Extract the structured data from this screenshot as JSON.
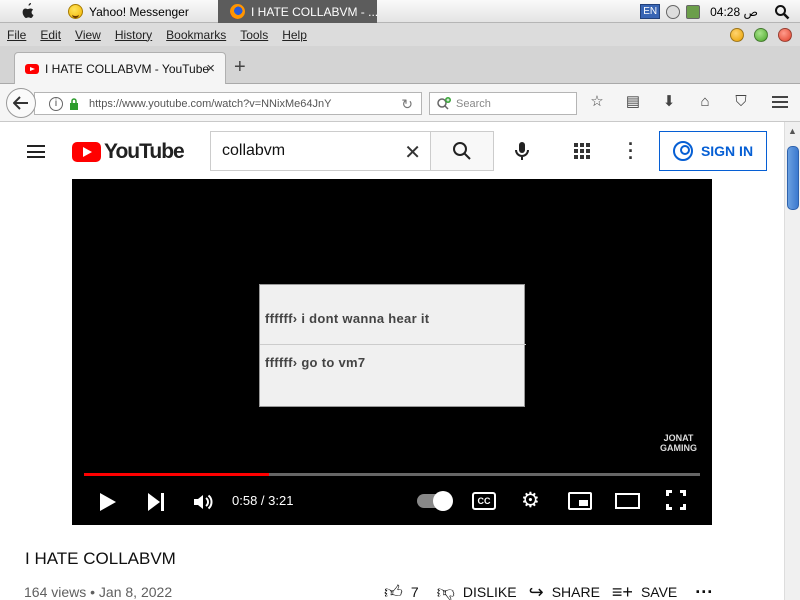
{
  "system_bar": {
    "task1_label": "Yahoo! Messenger",
    "task2_label": "I HATE COLLABVM - ...",
    "lang": "EN",
    "clock": "04:28 ص"
  },
  "menu": [
    "File",
    "Edit",
    "View",
    "History",
    "Bookmarks",
    "Tools",
    "Help"
  ],
  "tab": {
    "label": "I HATE COLLABVM - YouTube",
    "close": "×",
    "new_tab": "+"
  },
  "nav": {
    "url": "https://www.youtube.com/watch?v=NNixMe64JnY",
    "search_placeholder": "Search"
  },
  "youtube": {
    "logo_text": "YouTube",
    "search_value": "collabvm",
    "sign_in": "SIGN IN"
  },
  "player": {
    "chat_line_1": "ffffff› i dont wanna hear it",
    "chat_line_2": "ffffff› go to vm7",
    "watermark_1": "JONAT",
    "watermark_2": "GAMING",
    "time": "0:58 / 3:21",
    "progress": 0.3,
    "cc_label": "CC"
  },
  "video": {
    "title": "I HATE COLLABVM",
    "meta": "164 views • Jan 8, 2022",
    "likes": "7",
    "dislike": "DISLIKE",
    "share": "SHARE",
    "save": "SAVE"
  },
  "colors": {
    "accent": "#065fd4",
    "yt_red": "#ff0000"
  }
}
